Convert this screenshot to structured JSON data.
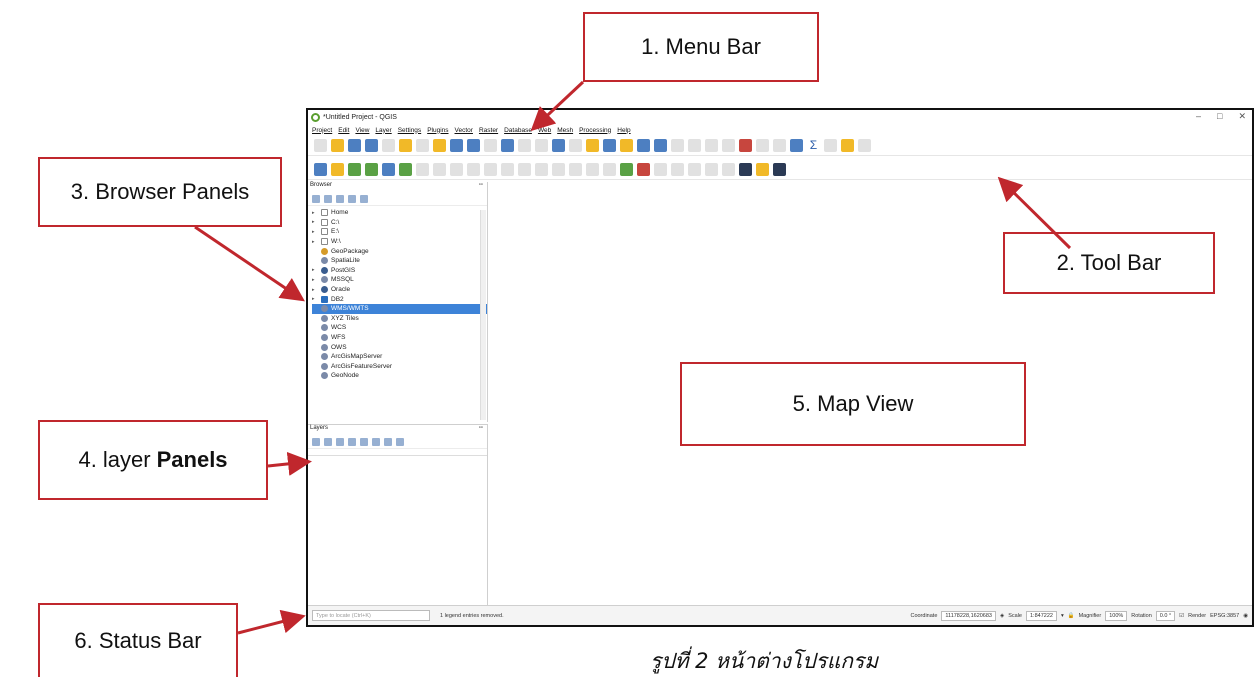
{
  "window": {
    "title": "*Untitled Project - QGIS",
    "controls": [
      "–",
      "□",
      "✕"
    ]
  },
  "menubar": [
    "Project",
    "Edit",
    "View",
    "Layer",
    "Settings",
    "Plugins",
    "Vector",
    "Raster",
    "Database",
    "Web",
    "Mesh",
    "Processing",
    "Help"
  ],
  "browser": {
    "title": "Browser",
    "items": [
      "Home",
      "C:\\",
      "E:\\",
      "W:\\",
      "GeoPackage",
      "SpatiaLite",
      "PostGIS",
      "MSSQL",
      "Oracle",
      "DB2",
      "WMS/WMTS",
      "XYZ Tiles",
      "WCS",
      "WFS",
      "OWS",
      "ArcGisMapServer",
      "ArcGisFeatureServer",
      "GeoNode"
    ],
    "selected": "WMS/WMTS"
  },
  "layers": {
    "title": "Layers"
  },
  "statusbar": {
    "locator_placeholder": "Type to locate (Ctrl+K)",
    "message": "1 legend entries removed.",
    "coordinate_label": "Coordinate",
    "coordinate_value": "11178228,1620683",
    "scale_label": "Scale",
    "scale_value": "1:847222",
    "magnifier_label": "Magnifier",
    "magnifier_value": "100%",
    "rotation_label": "Rotation",
    "rotation_value": "0.0 °",
    "render_label": "Render",
    "crs": "EPSG:3857"
  },
  "callouts": {
    "menu_bar": "1. Menu Bar",
    "tool_bar": "2. Tool Bar",
    "browser_panels": "3. Browser Panels",
    "layer_panels_prefix": "4. layer",
    "layer_panels_bold": "Panels",
    "map_view": "5. Map View",
    "status_bar": "6. Status Bar"
  },
  "caption": "รูปที่ 2 หน้าต่างโปรแกรม",
  "colors": {
    "callout_border": "#c0272d",
    "selection": "#3d83d8"
  }
}
